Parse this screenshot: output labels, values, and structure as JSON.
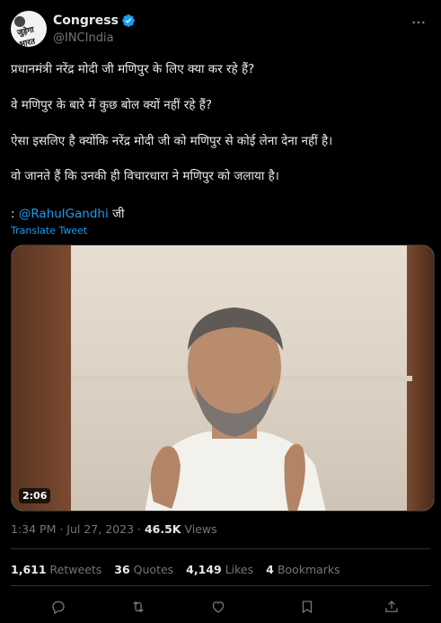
{
  "author": {
    "name": "Congress",
    "handle": "@INCIndia",
    "avatar_text": "जुड़ेगा भारत"
  },
  "tweet": {
    "lines": [
      "प्रधानमंत्री नरेंद्र मोदी जी मणिपुर के लिए क्या कर रहे हैं?",
      "वे मणिपुर के बारे में कुछ बोल क्यों नहीं रहे हैं?",
      "ऐसा इसलिए है क्योंकि नरेंद्र मोदी जी को मणिपुर से कोई लेना देना नहीं है।",
      "वो जानते हैं कि उनकी ही विचारधारा ने मणिपुर को जलाया है।"
    ],
    "credit_prefix": ": ",
    "credit_mention": "@RahulGandhi",
    "credit_suffix": " जी",
    "translate_label": "Translate Tweet"
  },
  "video": {
    "duration": "2:06"
  },
  "meta": {
    "time": "1:34 PM",
    "separator": " · ",
    "date": "Jul 27, 2023",
    "views_count": "46.5K",
    "views_label": " Views"
  },
  "stats": {
    "retweets_count": "1,611",
    "retweets_label": "Retweets",
    "quotes_count": "36",
    "quotes_label": "Quotes",
    "likes_count": "4,149",
    "likes_label": "Likes",
    "bookmarks_count": "4",
    "bookmarks_label": "Bookmarks"
  },
  "colors": {
    "background": "#000000",
    "text": "#e7e9ea",
    "muted": "#71767b",
    "accent": "#1d9bf0",
    "divider": "#2f3336"
  },
  "icons": [
    "verified-badge-icon",
    "more-icon",
    "reply-icon",
    "retweet-icon",
    "like-icon",
    "bookmark-icon",
    "share-icon"
  ]
}
